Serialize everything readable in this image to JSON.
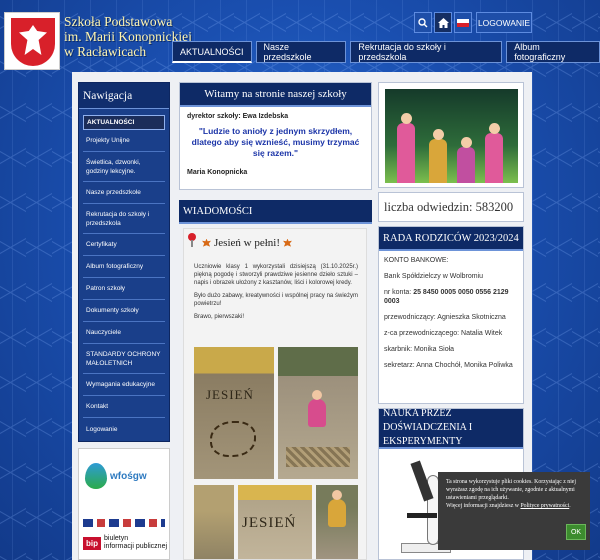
{
  "header": {
    "school_line1": "Szkoła Podstawowa",
    "school_line2": "im. Marii Konopnickiej",
    "school_line3": "w Racławicach",
    "login_label": "LOGOWANIE"
  },
  "menu": [
    {
      "label": "AKTUALNOŚCI"
    },
    {
      "label": "Nasze przedszkole"
    },
    {
      "label": "Rekrutacja do szkoły i przedszkola"
    },
    {
      "label": "Album fotograficzny"
    }
  ],
  "nav": {
    "title": "Nawigacja",
    "items": [
      {
        "label": "AKTUALNOŚCI"
      },
      {
        "label": "Projekty Unijne"
      },
      {
        "label": "Świetlica, dzwonki, godziny lekcyjne."
      },
      {
        "label": "Nasze przedszkole"
      },
      {
        "label": "Rekrutacja do szkoły i przedszkola"
      },
      {
        "label": "Certyfikaty"
      },
      {
        "label": "Album fotograficzny"
      },
      {
        "label": "Patron szkoły"
      },
      {
        "label": "Dokumenty szkoły"
      },
      {
        "label": "Nauczyciele"
      },
      {
        "label": "STANDARDY OCHRONY MAŁOLETNICH"
      },
      {
        "label": "Wymagania edukacyjne"
      },
      {
        "label": "Kontakt"
      },
      {
        "label": "Logowanie"
      }
    ]
  },
  "side_logos": {
    "wfos": "wfośgw",
    "bip_badge": "bip",
    "bip_line1": "biuletyn",
    "bip_line2": "informacji publicznej"
  },
  "welcome": {
    "title": "Witamy na stronie naszej szkoły",
    "director": "dyrektor szkoły: Ewa Izdebska",
    "quote": "\"Ludzie to anioły z jednym skrzydłem,  dlatego aby się wznieść, musimy trzymać się razem.\"",
    "author": "Maria Konopnicka"
  },
  "news": {
    "title": "WIADOMOŚCI",
    "post_title": "Jesień w pełni!",
    "para1": "Uczniowie klasy 1 wykorzystali dzisiejszą (31.10.2025r.) piękną pogodę i stworzyli prawdziwe jesienne dzieło sztuki – napis i obrazek ułożony z kasztanów, liści i kolorowej kredy.",
    "para2": "Było dużo zabawy, kreatywności i wspólnej pracy na świeżym powietrzu!",
    "para3": "Brawo, pierwszaki!",
    "photo_text1": "JESIEŃ",
    "photo_text2": "JESIEŃ"
  },
  "visits": {
    "label": "liczba odwiedzin: 583200"
  },
  "rada": {
    "title": "RADA RODZICÓW 2023/2024",
    "konto_bankowe": "KONTO BANKOWE:",
    "bank": "Bank Spółdzielczy w Wolbromiu",
    "nr_label": "nr konta:",
    "nr_value": "25 8450 0005 0050 0556 2129 0003",
    "przew": "przewodniczący: Agnieszka Skotniczna",
    "zca": "z-ca przewodniczącego:  Natalia Witek",
    "skarbnik": "skarbnik: Monika Sioła",
    "sekretarz": "sekretarz:  Anna Chochół, Monika Poliwka"
  },
  "nauka": {
    "title": "NAUKA PRZEZ DOŚWIADCZENIA I EKSPERYMENTY"
  },
  "cookie": {
    "text": "Ta strona wykorzystuje pliki cookies. Korzystając z niej wyrażasz zgodę na ich używanie, zgodnie z aktualnymi ustawieniami przeglądarki.",
    "more": "Więcej informacji znajdziesz w",
    "link": "Polityce prywatności",
    "ok": "OK"
  },
  "colors": {
    "brand_blue": "#0e2a66",
    "accent_blue": "#1a4fb0",
    "quote_blue": "#1c35a8",
    "ok_green": "#3c8c2e"
  }
}
